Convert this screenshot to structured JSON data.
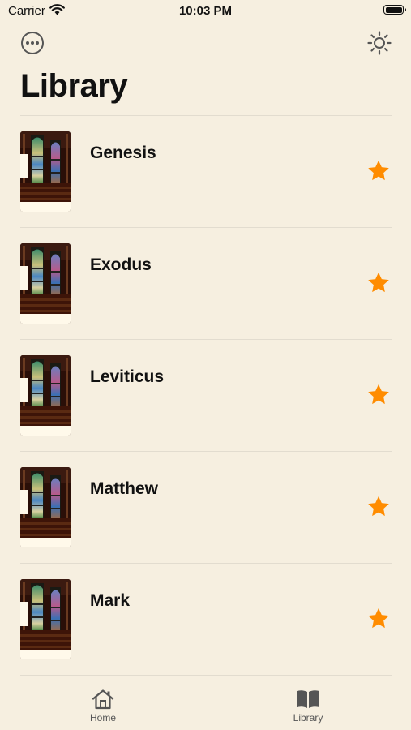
{
  "status_bar": {
    "carrier": "Carrier",
    "time": "10:03 PM"
  },
  "header": {
    "title": "Library",
    "more_icon": "ellipsis-circle-icon",
    "theme_icon": "sun-icon"
  },
  "books": [
    {
      "title": "Genesis",
      "favorite": true
    },
    {
      "title": "Exodus",
      "favorite": true
    },
    {
      "title": "Leviticus",
      "favorite": true
    },
    {
      "title": "Matthew",
      "favorite": true
    },
    {
      "title": "Mark",
      "favorite": true
    }
  ],
  "tabs": [
    {
      "label": "Home",
      "icon": "house-icon",
      "selected": false
    },
    {
      "label": "Library",
      "icon": "book-icon",
      "selected": true
    }
  ],
  "colors": {
    "background": "#f6efe0",
    "star": "#ff8c00",
    "icon_gray": "#555555"
  }
}
